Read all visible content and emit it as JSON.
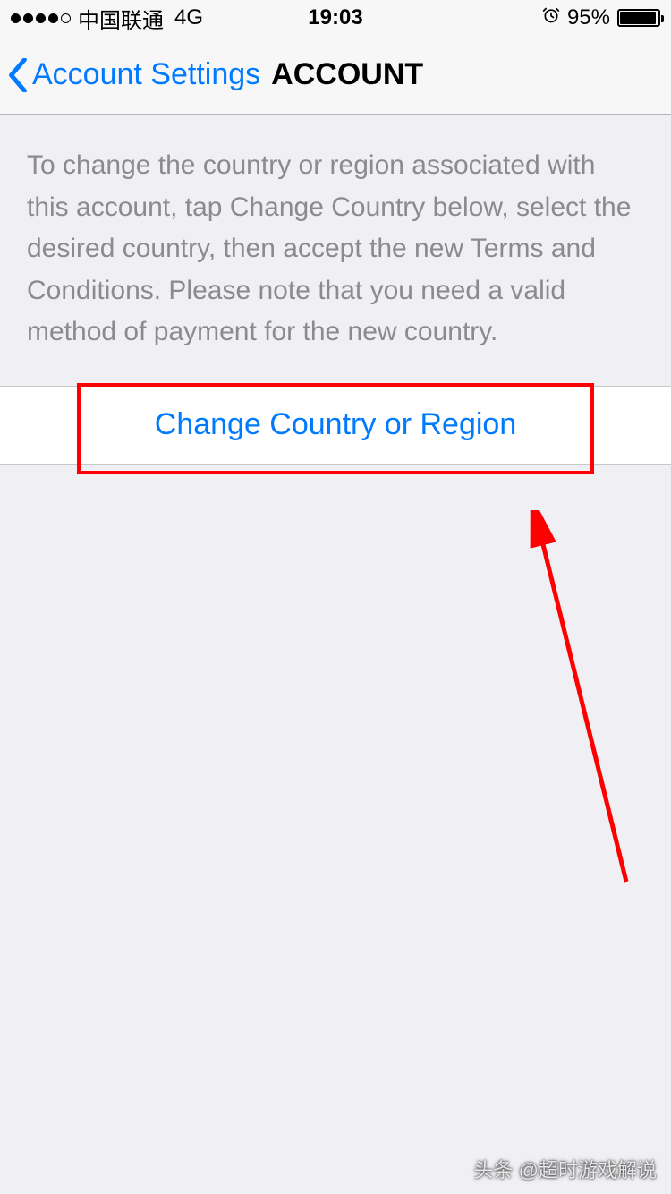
{
  "status_bar": {
    "carrier": "中国联通",
    "network": "4G",
    "time": "19:03",
    "battery_pct": "95%"
  },
  "nav": {
    "back_label": "Account Settings",
    "title": "ACCOUNT"
  },
  "description": "To change the country or region associated with this account, tap Change Country below, select the desired country, then accept the new Terms and Conditions. Please note that you need a valid method of payment for the new country.",
  "action": {
    "change_country_label": "Change Country or Region"
  },
  "watermark": "头条 @超时游戏解说"
}
